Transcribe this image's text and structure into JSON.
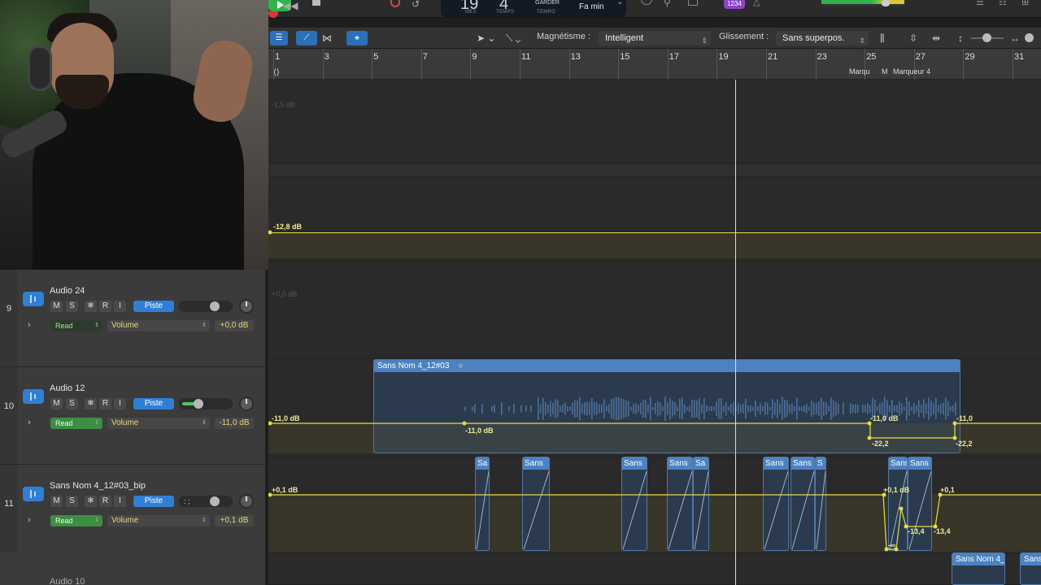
{
  "transport": {
    "lcd_bar": "19",
    "lcd_beat": "4",
    "lcd_bar_label": "MES",
    "lcd_beat_label": "TEMPS",
    "lcd_garder": "GARDER",
    "lcd_tempo_label": "TEMPO",
    "lcd_key": "Fa min",
    "count_in": "1234",
    "colors": {
      "play": "#2fb34a",
      "record": "#e0333b",
      "count_in": "#8a45c9"
    }
  },
  "arrange_toolbar": {
    "snap_label": "Magnétisme :",
    "snap_value": "Intelligent",
    "drag_label": "Glissement :",
    "drag_value": "Sans superpos."
  },
  "ruler": {
    "bars": [
      "1",
      "3",
      "5",
      "7",
      "9",
      "11",
      "13",
      "15",
      "17",
      "19",
      "21",
      "23",
      "25",
      "27",
      "29",
      "31"
    ],
    "markers": [
      "Marqu",
      "M",
      "Marqueur 4"
    ]
  },
  "lanes_above": {
    "ghost_top": "-1,5 dB",
    "auto_value": "-12,8 dB",
    "ghost_bottom": "+0,0 dB"
  },
  "tracks": [
    {
      "number": "9",
      "name": "Audio 24",
      "buttons": [
        "M",
        "S",
        "❄",
        "R",
        "I"
      ],
      "piste_label": "Piste",
      "mode": "Read",
      "param": "Volume",
      "db": "+0,0 dB",
      "fader_level": 0.7,
      "auto_on": false
    },
    {
      "number": "10",
      "name": "Audio 12",
      "buttons": [
        "M",
        "S",
        "❄",
        "R",
        "I"
      ],
      "piste_label": "Piste",
      "mode": "Read",
      "param": "Volume",
      "db": "-11,0 dB",
      "fader_level": 0.3,
      "auto_on": true
    },
    {
      "number": "11",
      "name": "Sans Nom 4_12#03_bip",
      "buttons": [
        "M",
        "S",
        "❄",
        "R",
        "I"
      ],
      "piste_label": "Piste",
      "mode": "Read",
      "param": "Volume",
      "db": "+0,1 dB",
      "fader_level": 0.7,
      "meter_text": ": ;",
      "auto_on": true
    }
  ],
  "next_track": {
    "name": "Audio 10"
  },
  "regions": {
    "main_title": "Sans Nom 4_12#03",
    "main_auto_start": "-11,0 dB",
    "main_auto_mid": "-11,0 dB",
    "main_auto_dip_top": "-11,0 dB",
    "main_auto_dip_low_left": "-22,2",
    "main_auto_dip_low_right": "-22,2",
    "main_auto_end": "-11,0",
    "bip_clips": [
      "Sa",
      "Sans",
      "Sans",
      "Sans",
      "Sa",
      "Sans",
      "Sans",
      "S",
      "Sans",
      "Sans"
    ],
    "bip_auto_start": "+0,1 dB",
    "bip_auto_a": "+0,1 dB",
    "bip_auto_inf": "-∞",
    "bip_auto_b": "-13,4",
    "bip_auto_c": "-13,4",
    "bip_auto_end": "+0,1",
    "bottom_clips": [
      "Sans Nom 4_",
      "Sans"
    ]
  },
  "colors": {
    "automation": "#e6dc4a",
    "region_header": "#4c82c2",
    "region_body": "#2b3a4d",
    "accent": "#2f7fd6",
    "read_on": "#3d8e43"
  }
}
